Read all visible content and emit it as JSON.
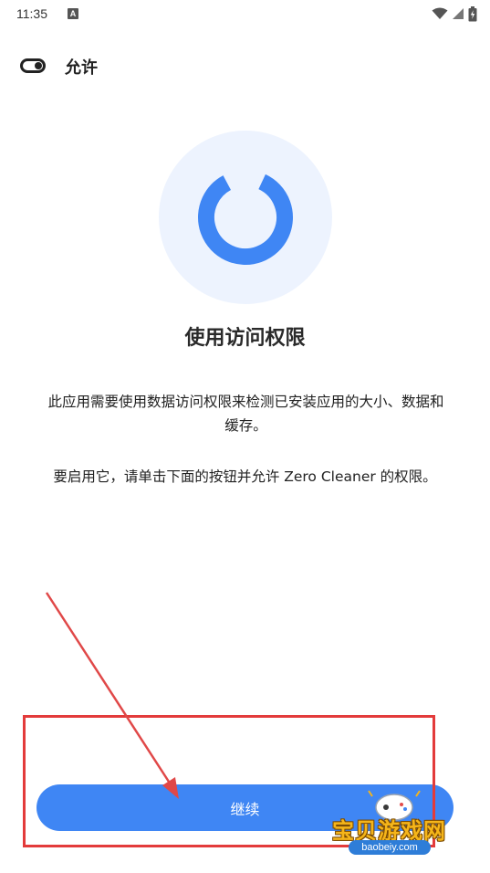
{
  "status_bar": {
    "time": "11:35",
    "notification_letter": "A",
    "icons": [
      "wifi-icon",
      "signal-icon",
      "battery-charging-icon"
    ]
  },
  "toolbar": {
    "toggle_icon": "toggle-switch-icon",
    "title": "允许"
  },
  "hero": {
    "icon": "storage-ring-icon",
    "circle_color": "#edf3fe",
    "ring_color": "#3f86f4"
  },
  "content": {
    "headline": "使用访问权限",
    "description": "此应用需要使用数据访问权限来检测已安装应用的大小、数据和缓存。",
    "instruction": "要启用它，请单击下面的按钮并允许 Zero Cleaner 的权限。"
  },
  "actions": {
    "continue_label": "继续",
    "button_color": "#3f86f4"
  },
  "annotation": {
    "highlight_color": "#e33b3b"
  },
  "watermark": {
    "site_name": "宝贝游戏网",
    "url": "baobeiy.com"
  }
}
